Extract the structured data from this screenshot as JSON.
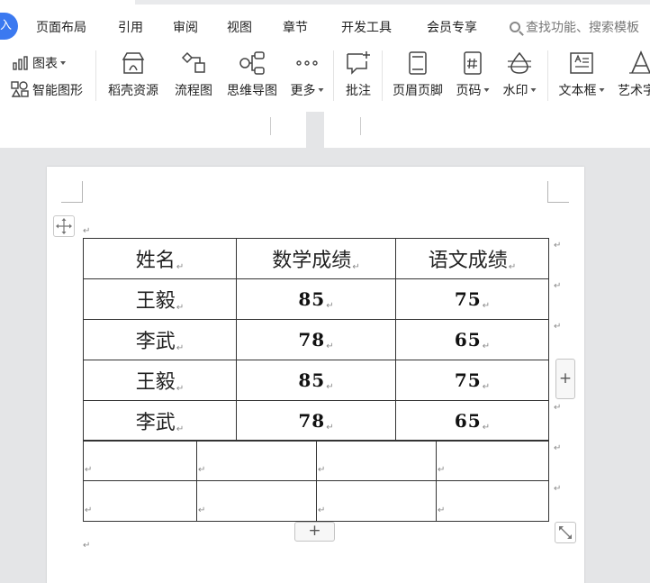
{
  "menu": {
    "insert_tab": "入",
    "items": [
      "页面布局",
      "引用",
      "审阅",
      "视图",
      "章节",
      "开发工具",
      "会员专享"
    ],
    "search_placeholder": "查找功能、搜索模板"
  },
  "toolbar": {
    "chart": "图表",
    "smart_art": "智能图形",
    "tools": [
      {
        "label": "稻壳资源",
        "icon": "docer-resource-icon"
      },
      {
        "label": "流程图",
        "icon": "flowchart-icon"
      },
      {
        "label": "思维导图",
        "icon": "mindmap-icon"
      },
      {
        "label": "更多",
        "icon": "more-dots-icon"
      },
      {
        "label": "批注",
        "icon": "comment-icon"
      },
      {
        "label": "页眉页脚",
        "icon": "header-footer-icon"
      },
      {
        "label": "页码",
        "icon": "page-number-icon"
      },
      {
        "label": "水印",
        "icon": "watermark-icon"
      },
      {
        "label": "文本框",
        "icon": "textbox-icon"
      },
      {
        "label": "艺术字",
        "icon": "wordart-icon"
      }
    ]
  },
  "table": {
    "headers": [
      "姓名",
      "数学成绩",
      "语文成绩"
    ],
    "rows": [
      [
        "王毅",
        "85",
        "75"
      ],
      [
        "李武",
        "78",
        "65"
      ],
      [
        "王毅",
        "85",
        "75"
      ],
      [
        "李武",
        "78",
        "65"
      ]
    ]
  },
  "marks": {
    "paragraph": "↵",
    "add": "+"
  }
}
